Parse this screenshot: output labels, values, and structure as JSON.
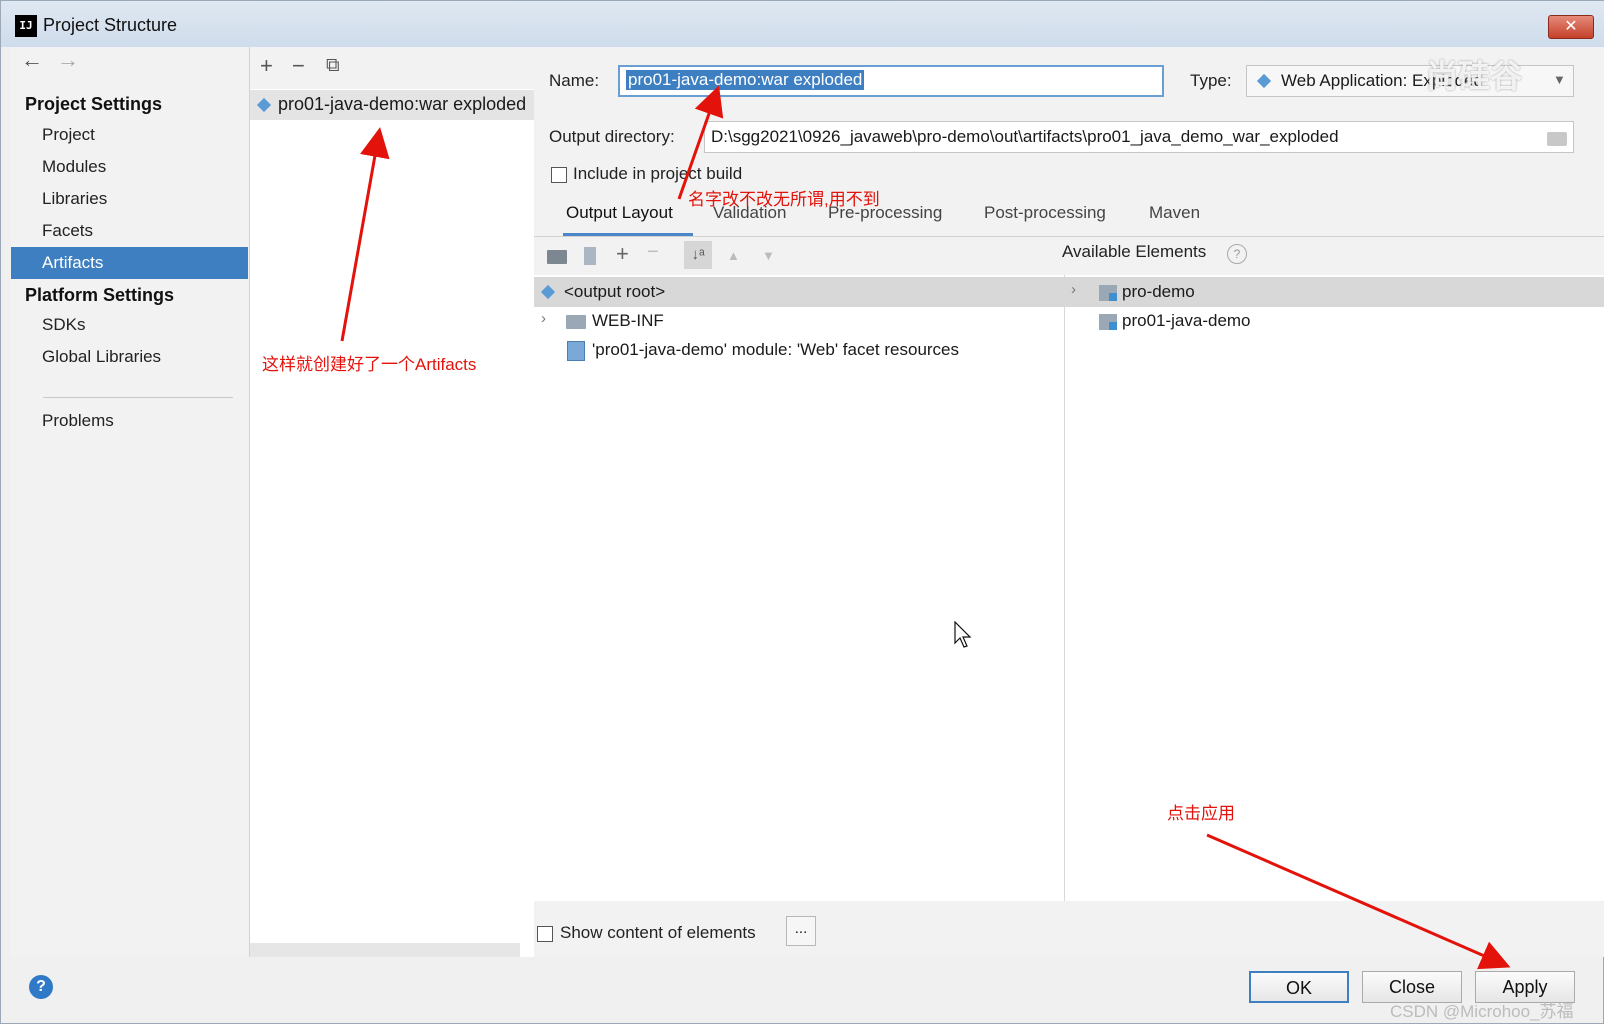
{
  "window": {
    "title": "Project Structure",
    "app_icon": "IJ",
    "close_glyph": "✕"
  },
  "nav": {
    "back_glyph": "←",
    "forward_glyph": "→",
    "project_settings_header": "Project Settings",
    "project_items": [
      "Project",
      "Modules",
      "Libraries",
      "Facets",
      "Artifacts"
    ],
    "selected_item": "Artifacts",
    "platform_settings_header": "Platform Settings",
    "platform_items": [
      "SDKs",
      "Global Libraries"
    ],
    "problems": "Problems"
  },
  "list": {
    "add_glyph": "+",
    "remove_glyph": "−",
    "copy_glyph": "⧉",
    "artifact": "pro01-java-demo:war exploded"
  },
  "detail": {
    "name_label": "Name:",
    "name_value": "pro01-java-demo:war exploded",
    "type_label": "Type:",
    "type_value": "Web Application: Exploded",
    "output_dir_label": "Output directory:",
    "output_dir_value": "D:\\sgg2021\\0926_javaweb\\pro-demo\\out\\artifacts\\pro01_java_demo_war_exploded",
    "include_in_build": "Include in project build",
    "tabs": [
      "Output Layout",
      "Validation",
      "Pre-processing",
      "Post-processing",
      "Maven"
    ],
    "active_tab": "Output Layout",
    "available_elements": "Available Elements",
    "tree": [
      "<output root>",
      "WEB-INF",
      "'pro01-java-demo' module: 'Web' facet resources"
    ],
    "available": [
      "pro-demo",
      "pro01-java-demo"
    ],
    "show_content": "Show content of elements",
    "dots": "..."
  },
  "buttons": {
    "ok": "OK",
    "close": "Close",
    "apply": "Apply",
    "help": "?"
  },
  "annotations": {
    "name_note": "名字改不改无所谓,用不到",
    "artifacts_note": "这样就创建好了一个Artifacts",
    "apply_note": "点击应用"
  },
  "watermarks": {
    "top": "尚硅谷",
    "bottom": "CSDN @Microhoo_苏福"
  },
  "colors": {
    "selection": "#3d7fc1",
    "annotation": "#e3120b"
  }
}
